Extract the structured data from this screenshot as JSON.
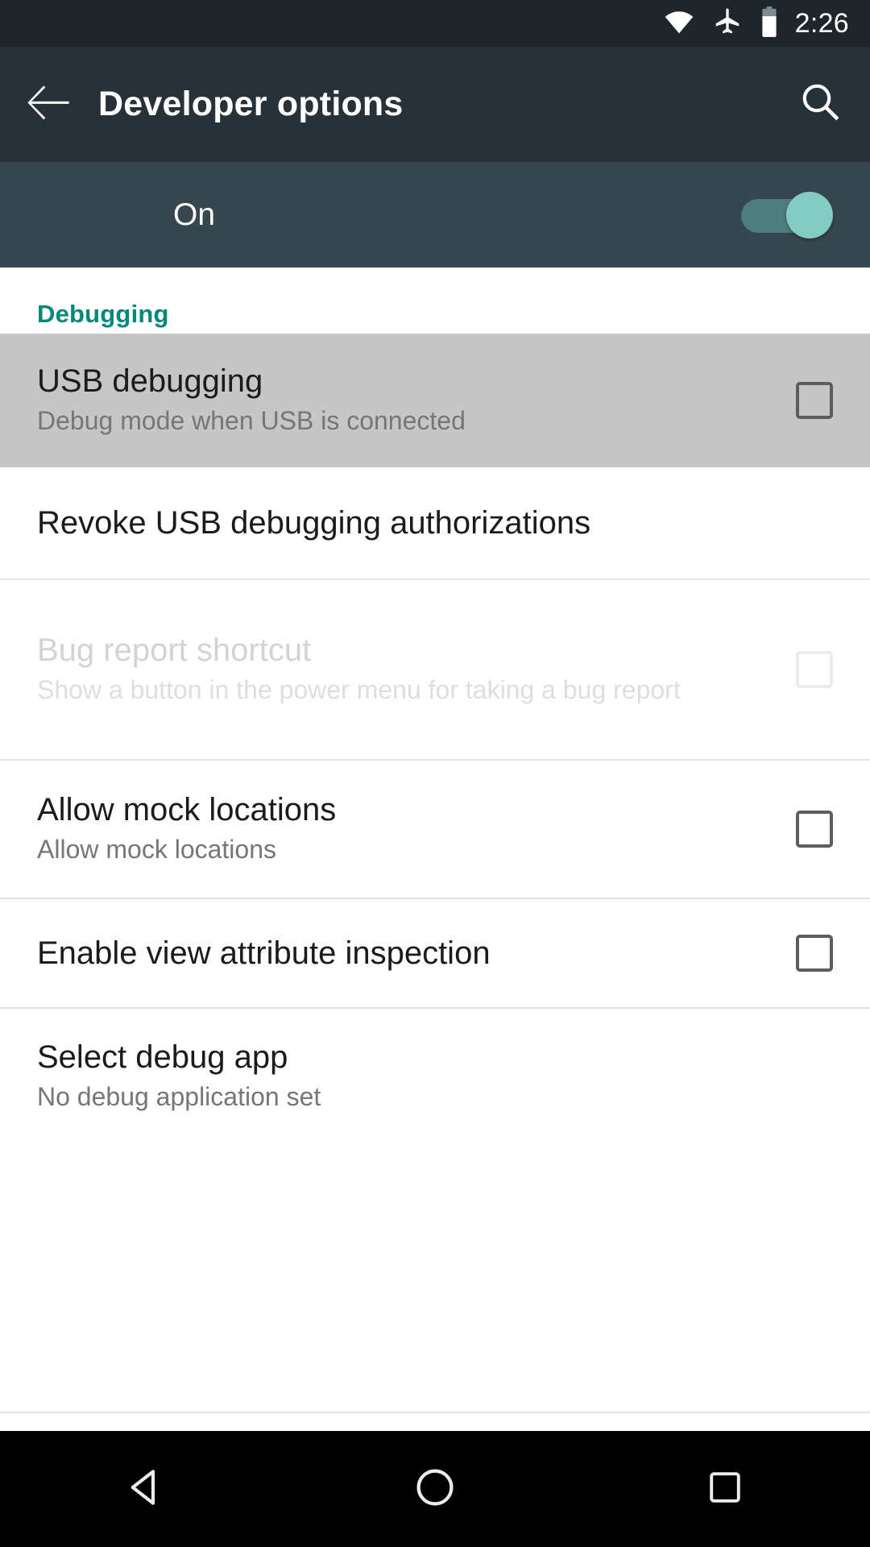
{
  "status_bar": {
    "time": "2:26",
    "icons": [
      "wifi-icon",
      "airplane-mode-icon",
      "battery-icon"
    ],
    "battery_level_pct": 70,
    "background": "#1e262b"
  },
  "app_bar": {
    "back_icon": "back-arrow-icon",
    "title": "Developer options",
    "search_icon": "search-icon",
    "background": "#263238"
  },
  "master_switch": {
    "label": "On",
    "enabled": true,
    "track_color": "#4e7d7d",
    "thumb_color": "#84cbc4",
    "background": "#37474f"
  },
  "sections": [
    {
      "header": "Debugging",
      "header_color": "#00897b",
      "rows": [
        {
          "name": "usb-debugging",
          "title": "USB debugging",
          "subtitle": "Debug mode when USB is connected",
          "control": "checkbox",
          "checked": false,
          "pressed": true,
          "disabled": false
        },
        {
          "name": "revoke-usb-debugging-authorizations",
          "title": "Revoke USB debugging authorizations",
          "subtitle": "",
          "control": "none",
          "checked": false,
          "pressed": false,
          "disabled": false
        },
        {
          "name": "bug-report-shortcut",
          "title": "Bug report shortcut",
          "subtitle": "Show a button in the power menu for taking a bug report",
          "control": "checkbox",
          "checked": false,
          "pressed": false,
          "disabled": true
        },
        {
          "name": "allow-mock-locations",
          "title": "Allow mock locations",
          "subtitle": "Allow mock locations",
          "control": "checkbox",
          "checked": false,
          "pressed": false,
          "disabled": false
        },
        {
          "name": "enable-view-attribute-inspection",
          "title": "Enable view attribute inspection",
          "subtitle": "",
          "control": "checkbox",
          "checked": false,
          "pressed": false,
          "disabled": false
        },
        {
          "name": "select-debug-app",
          "title": "Select debug app",
          "subtitle": "No debug application set",
          "control": "none",
          "checked": false,
          "pressed": false,
          "disabled": false
        }
      ]
    }
  ],
  "nav_bar": {
    "background": "#000000",
    "buttons": [
      {
        "name": "back-nav-icon",
        "label": "Back"
      },
      {
        "name": "home-nav-icon",
        "label": "Home"
      },
      {
        "name": "recents-nav-icon",
        "label": "Recents"
      }
    ]
  }
}
